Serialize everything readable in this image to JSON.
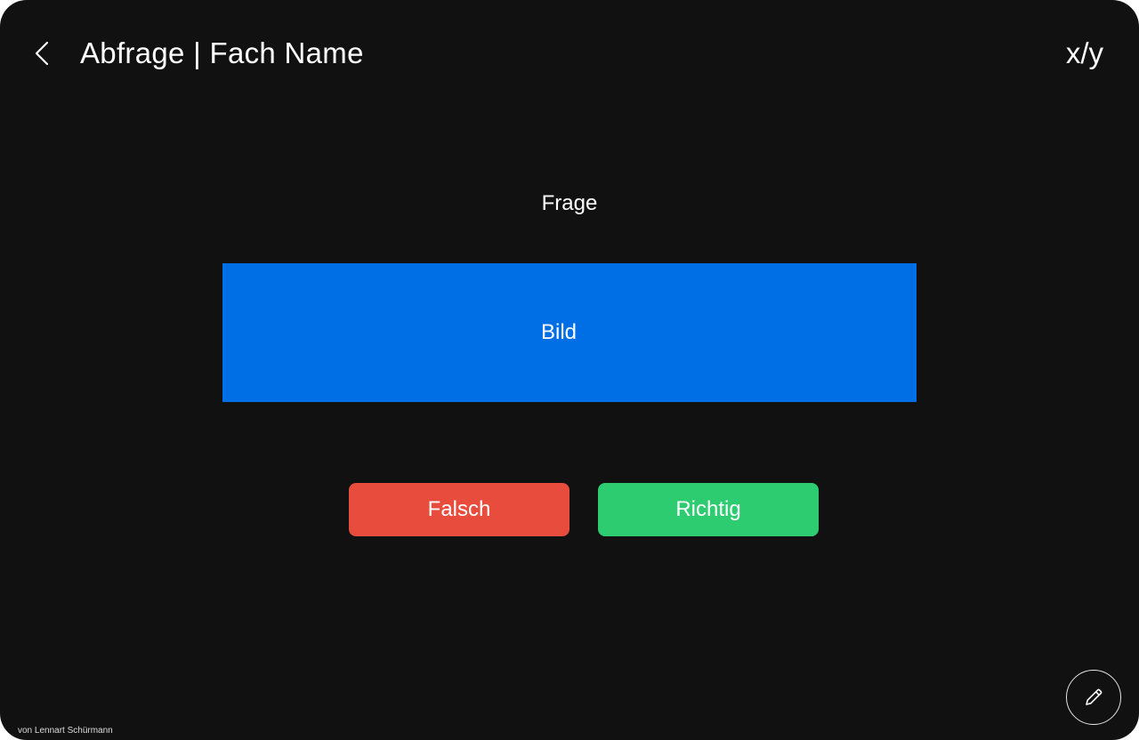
{
  "header": {
    "back_icon": "chevron-left-icon",
    "title": "Abfrage | Fach Name",
    "counter": "x/y"
  },
  "card": {
    "question": "Frage",
    "image_placeholder": "Bild",
    "image_color": "#006fe6"
  },
  "actions": {
    "wrong_label": "Falsch",
    "wrong_color": "#e74c3c",
    "right_label": "Richtig",
    "right_color": "#2ecc71"
  },
  "edit_button": {
    "icon": "pencil-icon"
  },
  "footer": {
    "credit": "von Lennart Schürmann"
  }
}
